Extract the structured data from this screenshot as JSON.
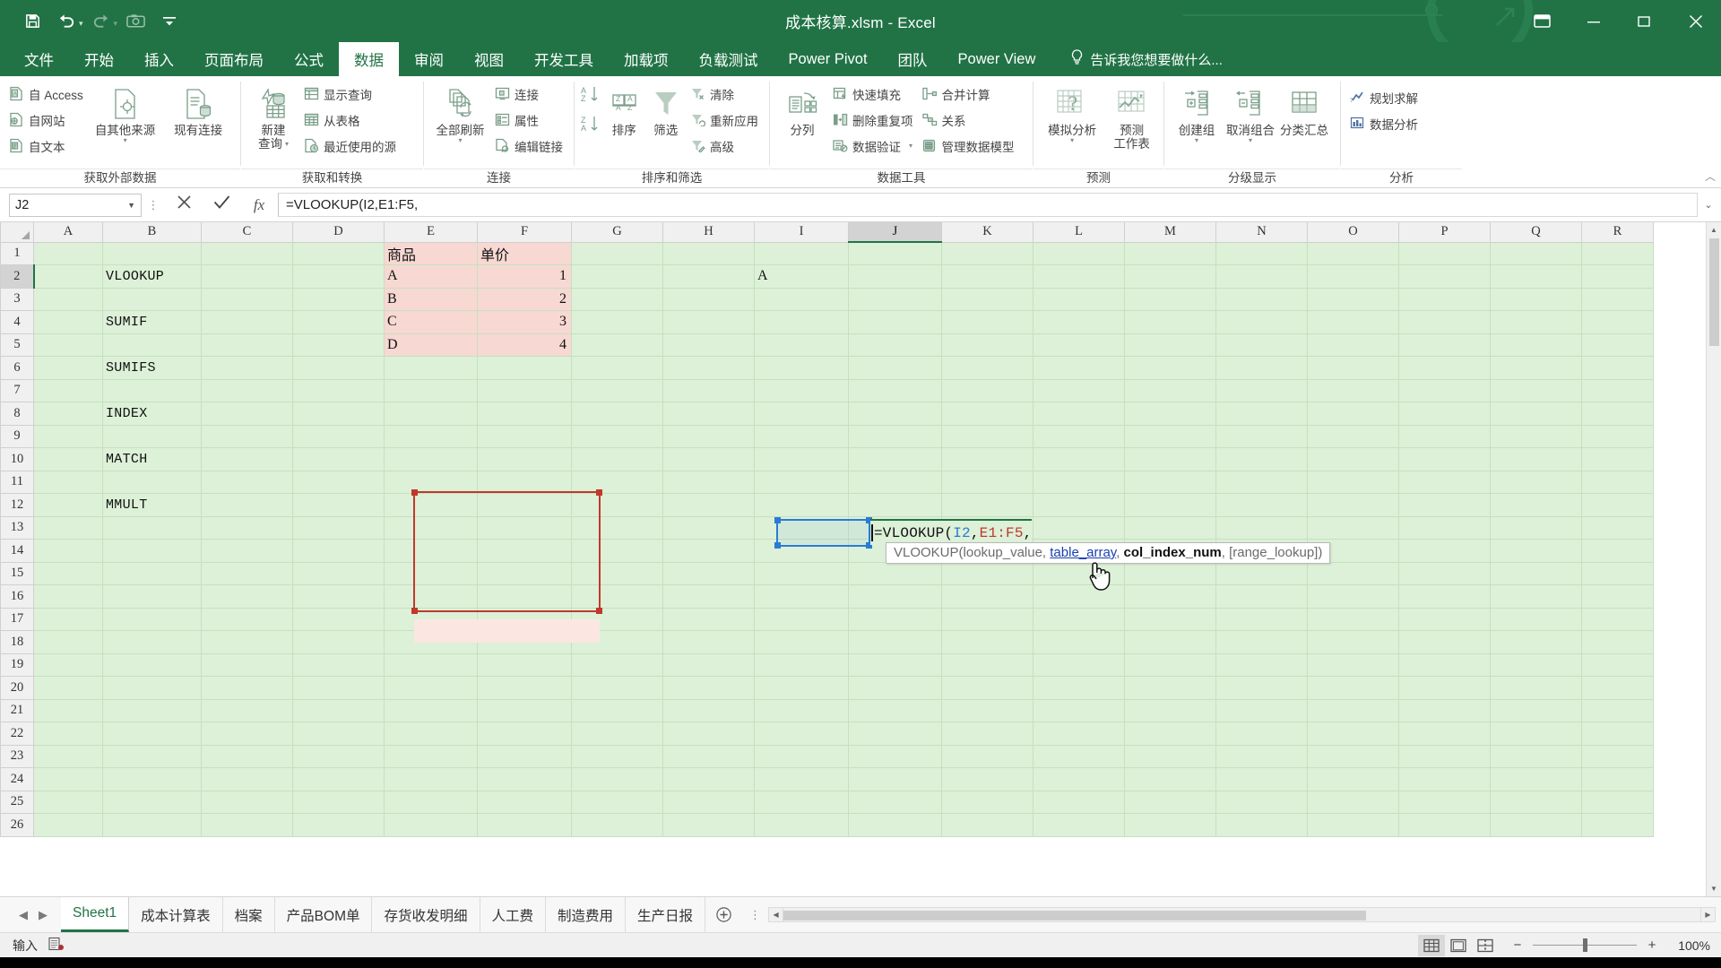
{
  "window": {
    "title": "成本核算.xlsm - Excel",
    "quick_access": [
      "save-icon",
      "undo-icon",
      "redo-icon",
      "camera-icon",
      "customize-qat-icon"
    ],
    "controls": [
      "ribbon-display-options-icon",
      "minimize-icon",
      "restore-icon",
      "close-icon"
    ]
  },
  "ribbon": {
    "tabs": [
      {
        "label": "文件",
        "active": false
      },
      {
        "label": "开始",
        "active": false
      },
      {
        "label": "插入",
        "active": false
      },
      {
        "label": "页面布局",
        "active": false
      },
      {
        "label": "公式",
        "active": false
      },
      {
        "label": "数据",
        "active": true
      },
      {
        "label": "审阅",
        "active": false
      },
      {
        "label": "视图",
        "active": false
      },
      {
        "label": "开发工具",
        "active": false
      },
      {
        "label": "加载项",
        "active": false
      },
      {
        "label": "负载测试",
        "active": false
      },
      {
        "label": "Power Pivot",
        "active": false
      },
      {
        "label": "团队",
        "active": false
      },
      {
        "label": "Power View",
        "active": false
      }
    ],
    "tell_me": "告诉我您想要做什么...",
    "groups": [
      {
        "name": "获取外部数据",
        "label": "获取外部数据",
        "small": [
          "自 Access",
          "自网站",
          "自文本"
        ],
        "big": [
          {
            "label1": "自其他来源",
            "label2": "",
            "dropdown": true
          },
          {
            "label1": "现有连接",
            "label2": "",
            "dropdown": false
          }
        ]
      },
      {
        "name": "获取和转换",
        "label": "获取和转换",
        "small": [
          "显示查询",
          "从表格",
          "最近使用的源"
        ],
        "big": [
          {
            "label1": "新建",
            "label2": "查询",
            "dropdown": true
          }
        ]
      },
      {
        "name": "连接",
        "label": "连接",
        "small": [
          "连接",
          "属性",
          "编辑链接"
        ],
        "big": [
          {
            "label1": "全部刷新",
            "label2": "",
            "dropdown": true
          }
        ]
      },
      {
        "name": "排序和筛选",
        "label": "排序和筛选",
        "small": [
          "清除",
          "重新应用",
          "高级"
        ],
        "big": [
          {
            "label1": "排序",
            "label2": "",
            "dropdown": false
          },
          {
            "label1": "筛选",
            "label2": "",
            "dropdown": false
          }
        ]
      },
      {
        "name": "数据工具",
        "label": "数据工具",
        "small": [
          "快速填充",
          "删除重复项",
          "数据验证",
          "合并计算",
          "关系",
          "管理数据模型"
        ],
        "big": [
          {
            "label1": "分列",
            "label2": "",
            "dropdown": false
          }
        ]
      },
      {
        "name": "预测",
        "label": "预测",
        "small": [],
        "big": [
          {
            "label1": "模拟分析",
            "label2": "",
            "dropdown": true
          },
          {
            "label1": "预测",
            "label2": "工作表",
            "dropdown": false
          }
        ]
      },
      {
        "name": "分级显示",
        "label": "分级显示",
        "small": [],
        "big": [
          {
            "label1": "创建组",
            "label2": "",
            "dropdown": true
          },
          {
            "label1": "取消组合",
            "label2": "",
            "dropdown": true
          },
          {
            "label1": "分类汇总",
            "label2": "",
            "dropdown": false
          }
        ]
      },
      {
        "name": "分析",
        "label": "分析",
        "small": [
          "规划求解",
          "数据分析"
        ],
        "big": []
      }
    ]
  },
  "formula_bar": {
    "name_box": "J2",
    "cancel_icon": "cancel-icon",
    "confirm_icon": "confirm-icon",
    "fx_icon": "insert-function-icon",
    "formula": "=VLOOKUP(I2,E1:F5,",
    "expand_icon": "expand-formula-bar-icon"
  },
  "grid": {
    "columns": [
      "A",
      "B",
      "C",
      "D",
      "E",
      "F",
      "G",
      "H",
      "I",
      "J",
      "K",
      "L",
      "M",
      "N",
      "O",
      "P",
      "Q",
      "R"
    ],
    "selected_column": "J",
    "selected_row": 2,
    "rows": [
      1,
      2,
      3,
      4,
      5,
      6,
      7,
      8,
      9,
      10,
      11,
      12,
      13,
      14,
      15,
      16,
      17,
      18,
      19,
      20,
      21,
      22,
      23,
      24,
      25,
      26
    ],
    "cells": {
      "B2": "VLOOKUP",
      "B4": "SUMIF",
      "B6": "SUMIFS",
      "B8": "INDEX",
      "B10": "MATCH",
      "B12": "MMULT",
      "E1": "商品",
      "F1": "单价",
      "E2": "A",
      "F2": "1",
      "E3": "B",
      "F3": "2",
      "E4": "C",
      "F4": "3",
      "E5": "D",
      "F5": "4",
      "I2": "A"
    },
    "editing_cell": {
      "ref": "J2",
      "text": "=VLOOKUP(I2,E1:F5,",
      "tokens": [
        {
          "t": "=VLOOKUP(",
          "color": "#111111"
        },
        {
          "t": "I2",
          "color": "#2a7bd4"
        },
        {
          "t": ",",
          "color": "#111111"
        },
        {
          "t": "E1:F5",
          "color": "#c0392b"
        },
        {
          "t": ",",
          "color": "#111111"
        }
      ]
    },
    "tooltip": {
      "prefix": "VLOOKUP(lookup_value, ",
      "link": "table_array",
      "middle": ", ",
      "bold": "col_index_num",
      "suffix": ", [range_lookup])"
    },
    "source_range": "E1:F5",
    "ref_range": "I2"
  },
  "sheet_tabs": {
    "nav_prev": "prev-sheet-icon",
    "nav_next": "next-sheet-icon",
    "tabs": [
      {
        "label": "Sheet1",
        "active": true
      },
      {
        "label": "成本计算表",
        "active": false
      },
      {
        "label": "档案",
        "active": false
      },
      {
        "label": "产品BOM单",
        "active": false
      },
      {
        "label": "存货收发明细",
        "active": false
      },
      {
        "label": "人工费",
        "active": false
      },
      {
        "label": "制造费用",
        "active": false
      },
      {
        "label": "生产日报",
        "active": false
      }
    ],
    "add_label": "＋"
  },
  "status_bar": {
    "mode": "输入",
    "macro_icon": "record-macro-icon",
    "views": [
      "normal-view-icon",
      "page-layout-view-icon",
      "page-break-view-icon"
    ],
    "active_view": 0,
    "zoom": "100%",
    "zoom_minus": "−",
    "zoom_plus": "+"
  },
  "colors": {
    "brand_green": "#217346",
    "sheet_fill": "#ddf0d8",
    "source_fill": "#f7d8d2",
    "source_border": "#c0392b",
    "ref_border": "#2a7bd4",
    "link_blue": "#1a3fb0"
  }
}
